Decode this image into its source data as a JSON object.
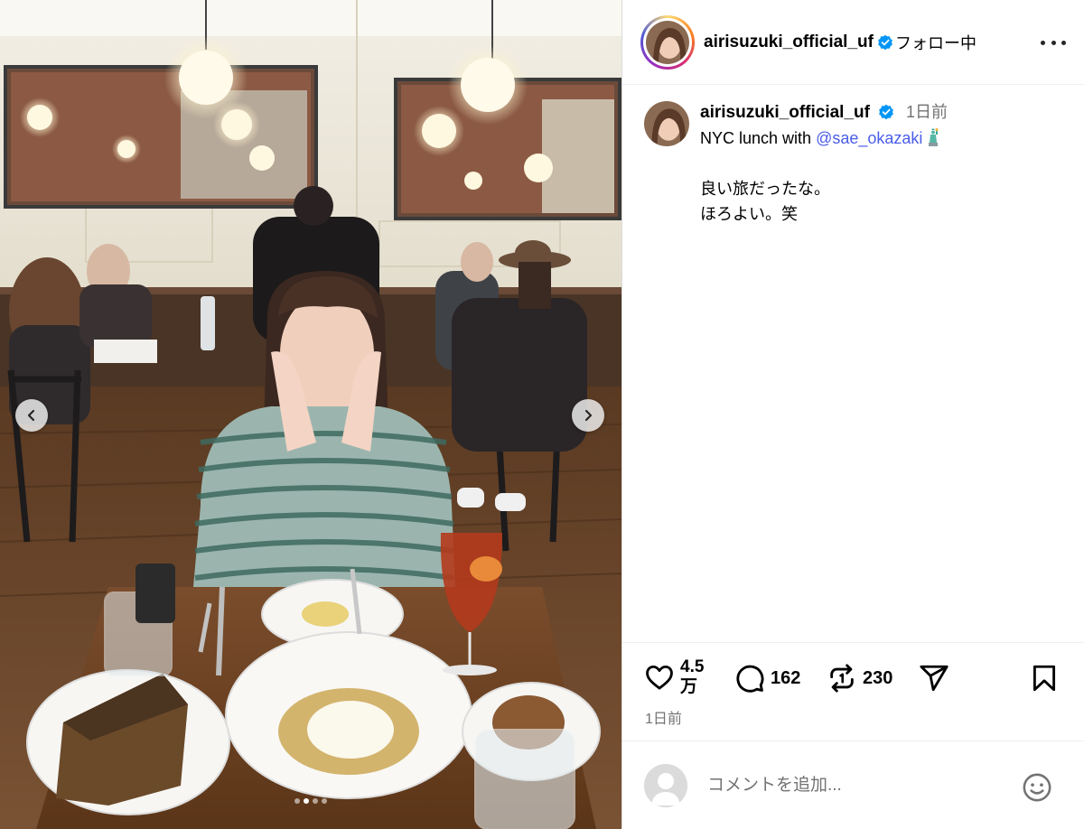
{
  "post": {
    "username": "airisuzuki_official_uf",
    "follow_status": "フォロー中",
    "caption_line1_prefix": "NYC lunch with ",
    "mention": "@sae_okazaki",
    "caption_line2": "良い旅だったな。",
    "caption_line3": "ほろよい。笑",
    "time_ago": "1日前",
    "likes": "4.5",
    "likes_unit": "万",
    "comments": "162",
    "reposts": "230",
    "comment_placeholder": "コメントを追加..."
  },
  "carousel": {
    "slide_count": 4,
    "active_index": 1
  },
  "icons": {
    "verified": "verified-badge-icon",
    "more": "more-icon",
    "like": "heart-icon",
    "comment": "comment-icon",
    "repost": "repost-icon",
    "share": "share-icon",
    "save": "bookmark-icon",
    "emoji": "emoji-icon",
    "prev": "chevron-left-icon",
    "next": "chevron-right-icon",
    "caption_emoji": "statue-of-liberty-emoji"
  },
  "colors": {
    "verified_blue": "#0095f6",
    "mention_blue": "#4a5de8",
    "muted_text": "#737373"
  }
}
